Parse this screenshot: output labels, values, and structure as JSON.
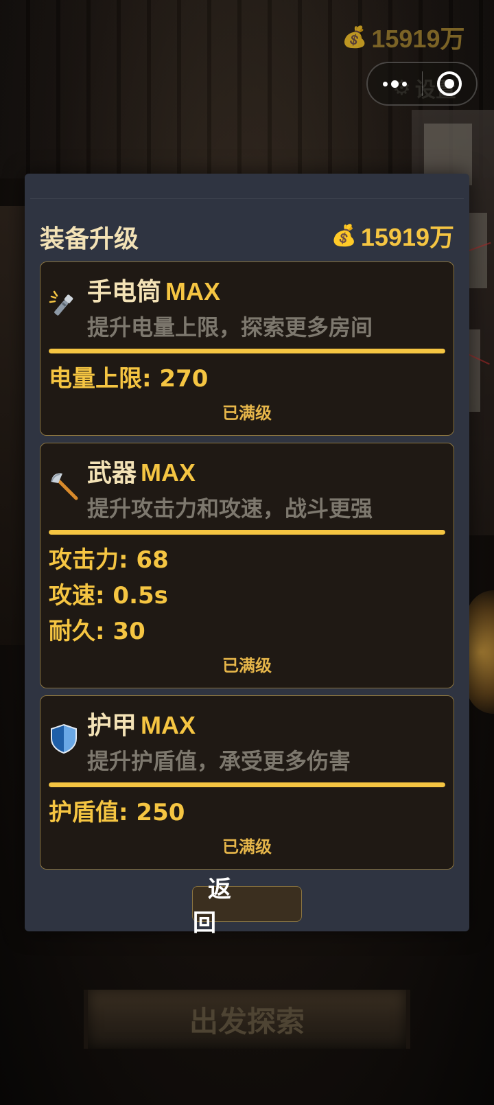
{
  "hud": {
    "money": "15919万",
    "settings_label": "设置"
  },
  "modal": {
    "title": "装备升级",
    "money": "15919万",
    "back_label": "返 回"
  },
  "equipment": [
    {
      "name": "手电筒",
      "level": "MAX",
      "description": "提升电量上限，探索更多房间",
      "icon": "flashlight-icon",
      "progress": 1.0,
      "stats": [
        "电量上限: 270"
      ],
      "status": "已满级"
    },
    {
      "name": "武器",
      "level": "MAX",
      "description": "提升攻击力和攻速，战斗更强",
      "icon": "axe-icon",
      "progress": 1.0,
      "stats": [
        "攻击力: 68",
        "攻速: 0.5s",
        "耐久: 30"
      ],
      "status": "已满级"
    },
    {
      "name": "护甲",
      "level": "MAX",
      "description": "提升护盾值，承受更多伤害",
      "icon": "shield-icon",
      "progress": 1.0,
      "stats": [
        "护盾值: 250"
      ],
      "status": "已满级"
    }
  ],
  "bottom": {
    "explore_label": "出发探索"
  },
  "colors": {
    "accent": "#f5c542",
    "panel": "#2f3441",
    "card": "#1f1914",
    "card_border": "#8a7440"
  }
}
